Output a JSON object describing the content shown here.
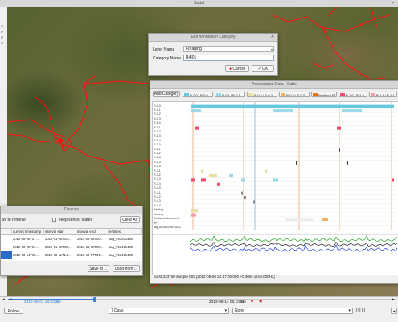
{
  "window": {
    "title": "Sattel",
    "close_glyph": "✕"
  },
  "left_tools": [
    "⌕",
    "⌕",
    "⌕",
    "⌕"
  ],
  "map": {
    "label": ""
  },
  "edit_category": {
    "title": "Edit Annotation Category",
    "layer_name_label": "Layer Name",
    "layer_name_value": "Foraging",
    "category_name_label": "Category Name",
    "category_name_value": "R4|01",
    "cancel_label": "Cancel",
    "ok_label": "OK"
  },
  "acceleration": {
    "title": "Acceleration Data - Sattel",
    "add_category_label": "Add Category",
    "chips": [
      {
        "label": "R-0,0 | R-0,0",
        "color": "#66c8e0"
      },
      {
        "label": "R-0,1 | R-0,1",
        "color": "#9cd9ea"
      },
      {
        "label": "R-0,2 | R-0,2",
        "color": "#e8e0a0"
      },
      {
        "label": "R-0,3 | R-0,3",
        "color": "#f0b060"
      },
      {
        "label": "Resting | R1",
        "color": "#e8741a"
      },
      {
        "label": "R-1,0 | R-1,0",
        "color": "#ef4a6a"
      },
      {
        "label": "R-1,1 | R-1,1",
        "color": "#f2a0b0"
      }
    ],
    "rows": [
      "R-0,0",
      "R-0,1",
      "R-0,2",
      "R-0,3",
      "R-1,0",
      "R-1,1",
      "R-1,2",
      "R-1,3",
      "R-1,4",
      "R-2,0",
      "R-2,1",
      "R-2,2",
      "R-2,3",
      "R-2,4",
      "R-3,0",
      "R-3,1",
      "R-3,2",
      "R-3,3",
      "R-3,4",
      "R-4,0",
      "R-4,1",
      "R-4,2",
      "R-4,3",
      "R-4,4",
      "Resting",
      "Moving",
      "Reduced Movement",
      "gps",
      "tag_#53461490: ACC"
    ],
    "bird_label": "Bird-1",
    "status": "burst 333700 sample 003 [2012-08-08 21:17:00.000 +0.300s @10.000Hz]"
  },
  "devices": {
    "title": "Devices",
    "rows_to_remove_label": "ws to remove",
    "keep_sensor_label": "keep sensor states",
    "clear_all_label": "Clear All",
    "columns": [
      "",
      "current timestamp",
      "interval start",
      "interval end",
      "entities"
    ],
    "rows": [
      [
        "",
        "2012-08-08T07...",
        "2012-01-08T03...",
        "2013-04-08T00...",
        "tag_#53461490"
      ],
      [
        "",
        "2012-08-05T04...",
        "2012-01-08T03...",
        "2013-04-08T00...",
        "tag_#53461490"
      ],
      [
        "",
        "2012-08-14T06...",
        "2012-08-11T14...",
        "2012-10-07T04...",
        "tag_#53461490"
      ]
    ],
    "save_label": "Save to ...",
    "load_label": "Load from ..."
  },
  "timeline": {
    "left_time": "2012-08-01 14:32:26",
    "left_time_suffix": "am",
    "current_time": "2012-08-14 06:10:59",
    "current_suffix": "am",
    "follow_label": "Follow",
    "days_label": "7 Days",
    "none_label": "None",
    "zoom_label": "[+] [-]"
  },
  "colors": {
    "accent": "#3c7ed0",
    "track": "#ff0000",
    "label": "#3355ff"
  }
}
